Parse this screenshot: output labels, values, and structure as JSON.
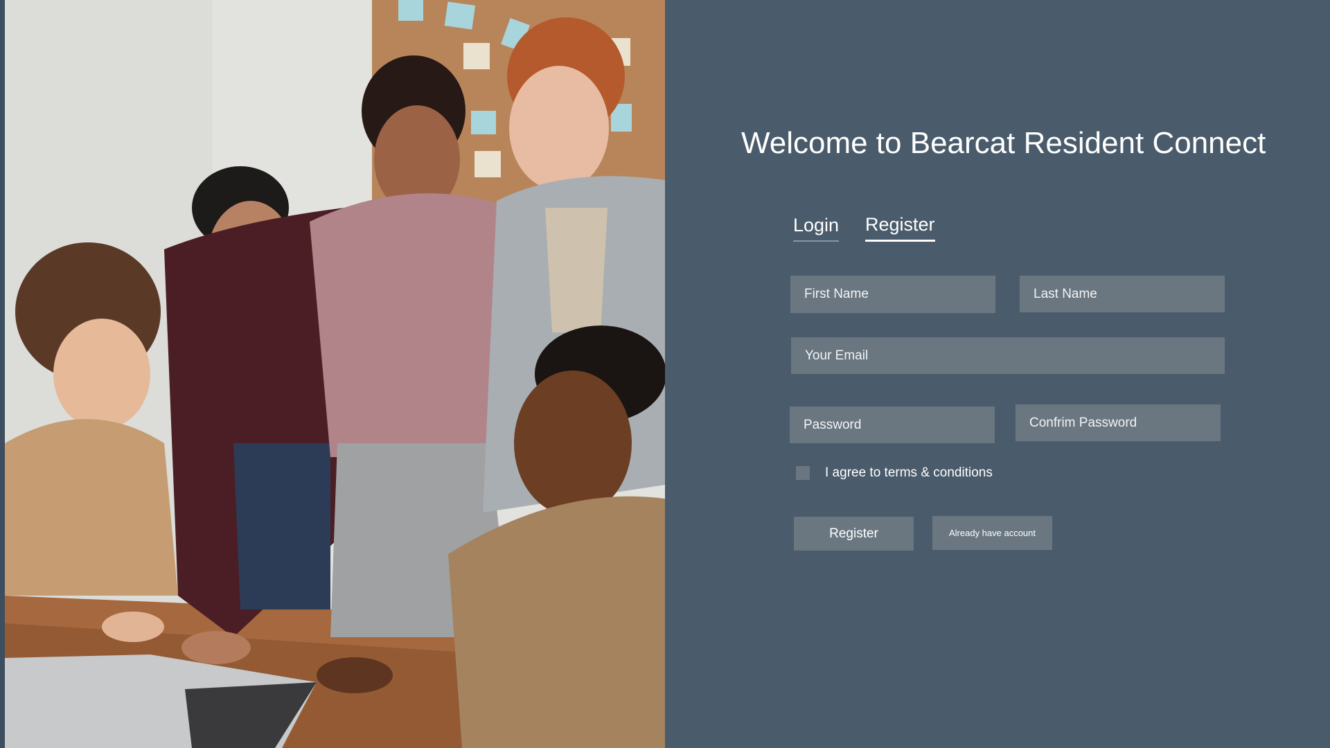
{
  "header": {
    "title": "Welcome to Bearcat Resident Connect"
  },
  "tabs": [
    {
      "label": "Login"
    },
    {
      "label": "Register"
    }
  ],
  "form": {
    "first_name": {
      "placeholder": "First Name",
      "value": ""
    },
    "last_name": {
      "placeholder": "Last Name",
      "value": ""
    },
    "email": {
      "placeholder": "Your Email",
      "value": ""
    },
    "password": {
      "placeholder": "Password",
      "value": ""
    },
    "confirm_password": {
      "placeholder": "Confrim Password",
      "value": ""
    },
    "terms_label": "I agree to terms & conditions",
    "terms_checked": false,
    "register_button": "Register",
    "already_button": "Already have account"
  },
  "colors": {
    "panel_bg": "#4a5b6b",
    "field_bg": "#6a7781",
    "text": "#ffffff"
  },
  "image": {
    "icon": "team-photo"
  }
}
